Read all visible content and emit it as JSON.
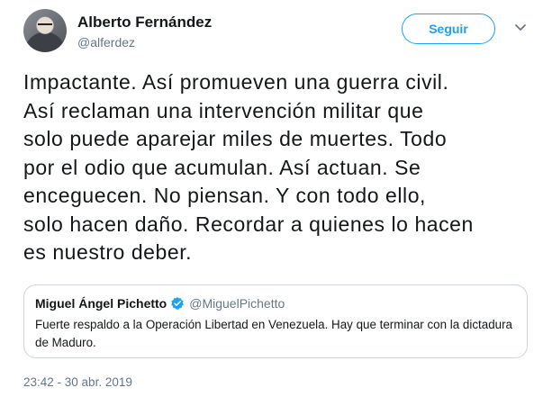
{
  "author": {
    "name": "Alberto Fernández",
    "handle": "@alferdez",
    "avatar_icon": "profile-photo"
  },
  "follow_button": {
    "label": "Seguir"
  },
  "more_menu": {
    "icon": "chevron-down-icon"
  },
  "tweet_text_lines": [
    "Impactante. Así promueven una guerra civil.",
    "Así reclaman una intervención militar que",
    "solo puede aparejar miles de muertes. Todo",
    "por el odio que acumulan. Así actuan. Se",
    "enceguecen. No piensan. Y con todo ello,",
    "solo hacen daño. Recordar a quienes lo hacen",
    "es nuestro deber."
  ],
  "quoted_tweet": {
    "name": "Miguel Ángel Pichetto",
    "verified_icon": "verified-badge-icon",
    "handle": "@MiguelPichetto",
    "text": "Fuerte respaldo a la Operación Libertad en Venezuela. Hay que terminar con la dictadura de Maduro."
  },
  "timestamp": "23:42 - 30 abr. 2019",
  "colors": {
    "accent": "#1da1f2",
    "text": "#14171a",
    "secondary": "#657786",
    "border": "#ccd6dd"
  }
}
